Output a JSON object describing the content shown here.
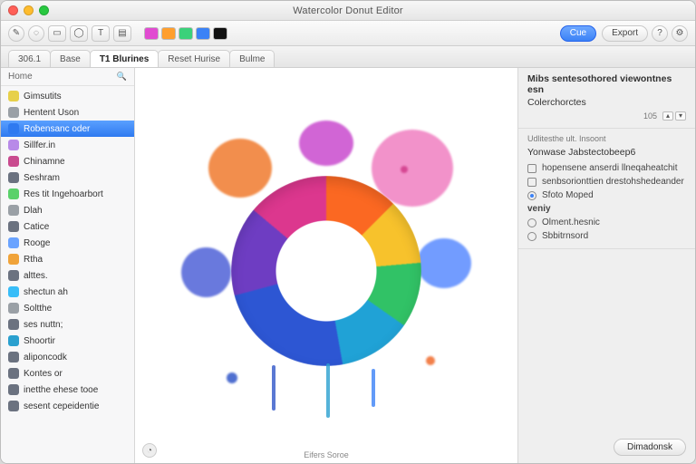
{
  "window": {
    "title": "Watercolor Donut Editor"
  },
  "toolbar": {
    "swatches": [
      "#e14bd1",
      "#ff9f2e",
      "#3bd17a",
      "#3b82f6",
      "#111111"
    ],
    "right_pills": [
      {
        "label": "Cue",
        "style": "solid"
      },
      {
        "label": "Export",
        "style": "ghost"
      }
    ]
  },
  "tabs": [
    {
      "label": "306.1",
      "active": false
    },
    {
      "label": "Base",
      "active": false
    },
    {
      "label": "T1 Blurines",
      "active": true
    },
    {
      "label": "Reset Hurise",
      "active": false
    },
    {
      "label": "Bulme",
      "active": false
    }
  ],
  "sidebar": {
    "header": "Home",
    "items": [
      {
        "label": "Gimsutits",
        "color": "#e7d04a"
      },
      {
        "label": "Hentent Uson",
        "color": "#9aa0a6"
      },
      {
        "label": "Robensanc oder",
        "color": "#2f7af0",
        "selected": true
      },
      {
        "label": "Sillfer.in",
        "color": "#b88ae8"
      },
      {
        "label": "Chinamne",
        "color": "#c94b8f"
      },
      {
        "label": "Seshram",
        "color": "#6b7280"
      },
      {
        "label": "Res tit Ingehoarbort",
        "color": "#5ad16a"
      },
      {
        "label": "Dlah",
        "color": "#9aa0a6"
      },
      {
        "label": "Catice",
        "color": "#6b7280"
      },
      {
        "label": "Rooge",
        "color": "#6aa3ff"
      },
      {
        "label": "Rtha",
        "color": "#f0a33a"
      },
      {
        "label": "alttes.",
        "color": "#6b7280"
      },
      {
        "label": "shectun ah",
        "color": "#38bdf8"
      },
      {
        "label": "Soltthe",
        "color": "#9aa0a6"
      },
      {
        "label": "ses nuttn;",
        "color": "#6b7280"
      },
      {
        "label": "Shoortir",
        "color": "#2aa0cf"
      },
      {
        "label": "aliponcodk",
        "color": "#6b7280"
      },
      {
        "label": "Kontes or",
        "color": "#6b7280"
      },
      {
        "label": "inetthe ehese tooe",
        "color": "#6b7280"
      },
      {
        "label": "sesent cepeidentie",
        "color": "#6b7280"
      }
    ]
  },
  "canvas": {
    "footer_text": "Eifers  Soroe",
    "corner_glyph": "◔"
  },
  "inspector": {
    "title_line1": "Mibs sentesothored viewontnes esn",
    "title_line2": "Colerchorctes",
    "badge_value": "105",
    "section_header": "Udlitesthe ult. Insoont",
    "group_label": "Yonwase Jabstectobeep6",
    "options": [
      {
        "kind": "checkbox",
        "label": "hopensene anserdi llneqaheatchit"
      },
      {
        "kind": "checkbox",
        "label": "senbsorionttien drestohshedeander"
      },
      {
        "kind": "radio",
        "label": "Sfoto Moped",
        "on": true
      },
      {
        "kind": "label",
        "label": "veniy"
      },
      {
        "kind": "radio",
        "label": "Olment.hesnic",
        "on": false
      },
      {
        "kind": "radio",
        "label": "Sbbitrnsord",
        "on": false
      }
    ],
    "footer_button": "Dimadonsk"
  }
}
